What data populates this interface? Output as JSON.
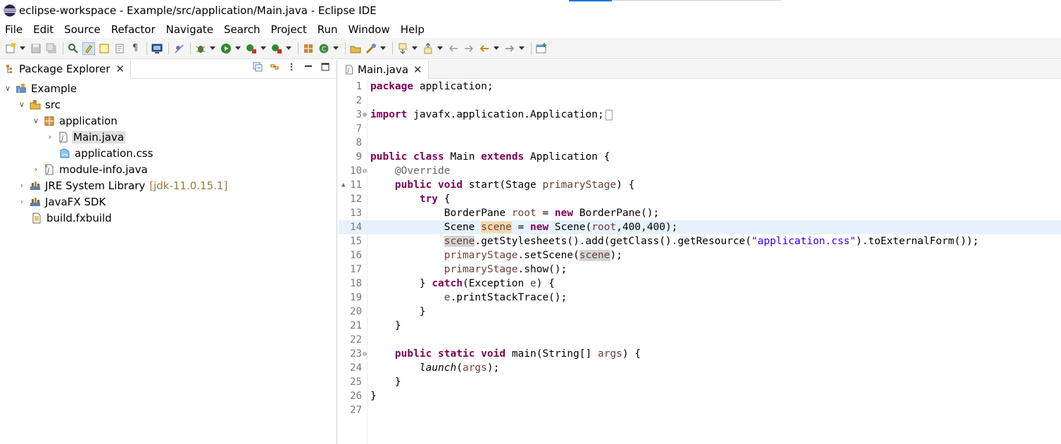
{
  "window": {
    "title": "eclipse-workspace - Example/src/application/Main.java - Eclipse IDE",
    "logo_icon": "eclipse-logo-icon"
  },
  "menu": [
    "File",
    "Edit",
    "Source",
    "Refactor",
    "Navigate",
    "Search",
    "Project",
    "Run",
    "Window",
    "Help"
  ],
  "package_explorer": {
    "tab_label": "Package Explorer",
    "tree": [
      {
        "label": "Example",
        "icon": "java-project-icon",
        "expanded": true,
        "level": 0
      },
      {
        "label": "src",
        "icon": "source-folder-icon",
        "expanded": true,
        "level": 1
      },
      {
        "label": "application",
        "icon": "package-icon",
        "expanded": true,
        "level": 2
      },
      {
        "label": "Main.java",
        "icon": "java-file-icon",
        "expanded": false,
        "level": 3,
        "selected": true
      },
      {
        "label": "application.css",
        "icon": "css-file-icon",
        "level": 4
      },
      {
        "label": "module-info.java",
        "icon": "java-file-icon",
        "expanded": false,
        "level": 2
      },
      {
        "label": "JRE System Library",
        "decoration": "[jdk-11.0.15.1]",
        "icon": "library-icon",
        "expanded": false,
        "level": 1
      },
      {
        "label": "JavaFX SDK",
        "icon": "library-icon",
        "expanded": false,
        "level": 1
      },
      {
        "label": "build.fxbuild",
        "icon": "fxbuild-file-icon",
        "level": 1
      }
    ]
  },
  "editor": {
    "tab_label": "Main.java",
    "current_line": 14,
    "lines": [
      {
        "n": "1",
        "text": "package application;"
      },
      {
        "n": "2",
        "text": ""
      },
      {
        "n": "3",
        "text": "import javafx.application.Application;"
      },
      {
        "n": "7",
        "text": ""
      },
      {
        "n": "8",
        "text": ""
      },
      {
        "n": "9",
        "text": "public class Main extends Application {"
      },
      {
        "n": "10",
        "text": "@Override"
      },
      {
        "n": "11",
        "text": "public void start(Stage primaryStage) {"
      },
      {
        "n": "12",
        "text": "try {"
      },
      {
        "n": "13",
        "text": "BorderPane root = new BorderPane();"
      },
      {
        "n": "14",
        "text": "Scene scene = new Scene(root,400,400);"
      },
      {
        "n": "15",
        "text": "scene.getStylesheets().add(getClass().getResource(\"application.css\").toExternalForm());"
      },
      {
        "n": "16",
        "text": "primaryStage.setScene(scene);"
      },
      {
        "n": "17",
        "text": "primaryStage.show();"
      },
      {
        "n": "18",
        "text": "} catch(Exception e) {"
      },
      {
        "n": "19",
        "text": "e.printStackTrace();"
      },
      {
        "n": "20",
        "text": "}"
      },
      {
        "n": "21",
        "text": "}"
      },
      {
        "n": "22",
        "text": ""
      },
      {
        "n": "23",
        "text": "public static void main(String[] args) {"
      },
      {
        "n": "24",
        "text": "launch(args);"
      },
      {
        "n": "25",
        "text": "}"
      },
      {
        "n": "26",
        "text": "}"
      },
      {
        "n": "27",
        "text": ""
      }
    ]
  },
  "colors": {
    "keyword": "#7f0055",
    "annotation": "#646464",
    "string": "#2a00ff",
    "local_variable": "#6a3e3e",
    "current_line": "#e8f2fe",
    "write_occurrence": "#f7d8a8",
    "read_occurrence": "#d4d4d4"
  }
}
